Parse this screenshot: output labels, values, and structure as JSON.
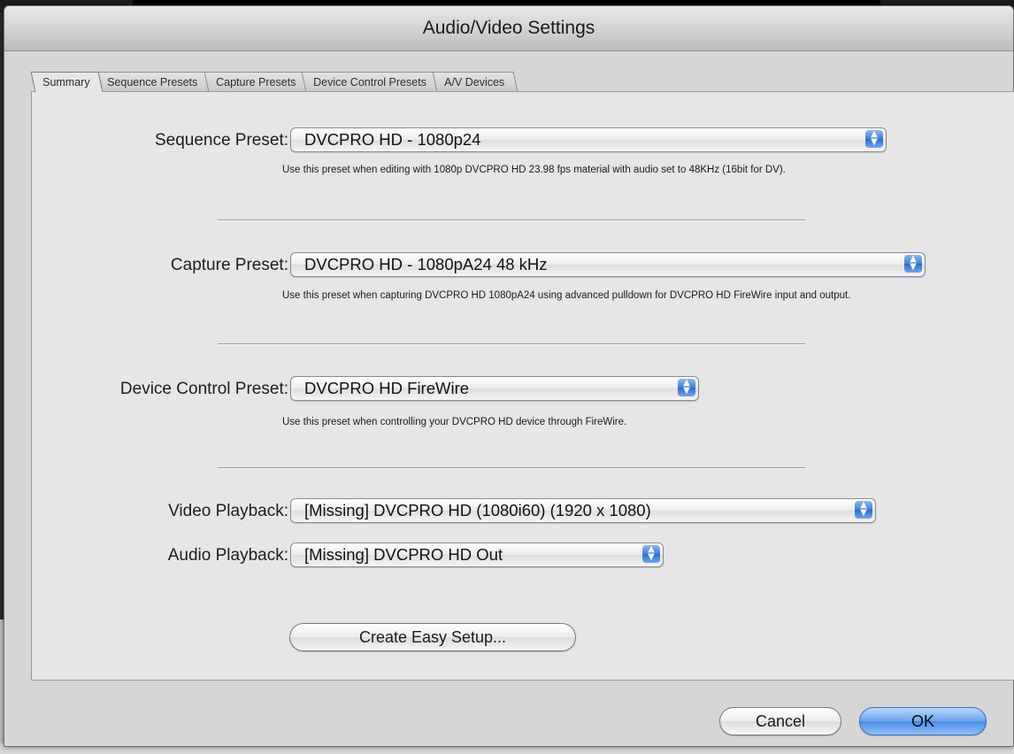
{
  "window": {
    "title": "Audio/Video Settings"
  },
  "tabs": [
    {
      "label": "Summary",
      "active": true
    },
    {
      "label": "Sequence Presets",
      "active": false
    },
    {
      "label": "Capture Presets",
      "active": false
    },
    {
      "label": "Device Control Presets",
      "active": false
    },
    {
      "label": "A/V Devices",
      "active": false
    }
  ],
  "sequence_preset": {
    "label": "Sequence Preset:",
    "value": "DVCPRO HD - 1080p24",
    "description": "Use this preset when editing with 1080p DVCPRO HD 23.98 fps material with audio set to 48KHz (16bit for DV)."
  },
  "capture_preset": {
    "label": "Capture Preset:",
    "value": "DVCPRO HD - 1080pA24 48 kHz",
    "description": "Use this preset when capturing DVCPRO HD 1080pA24 using advanced pulldown for DVCPRO HD FireWire input and output."
  },
  "device_control_preset": {
    "label": "Device Control Preset:",
    "value": "DVCPRO HD FireWire",
    "description": "Use this preset when controlling your DVCPRO HD device through FireWire."
  },
  "video_playback": {
    "label": "Video Playback:",
    "value": "[Missing] DVCPRO HD (1080i60) (1920 x 1080)"
  },
  "audio_playback": {
    "label": "Audio Playback:",
    "value": "[Missing] DVCPRO HD Out"
  },
  "buttons": {
    "create_easy_setup": "Create Easy Setup...",
    "cancel": "Cancel",
    "ok": "OK"
  },
  "colors": {
    "default_button": "#4a8ce6",
    "popup_arrows": "#3e7fdc",
    "panel": "#e6e6e6",
    "dialog": "#d6d6d6"
  }
}
